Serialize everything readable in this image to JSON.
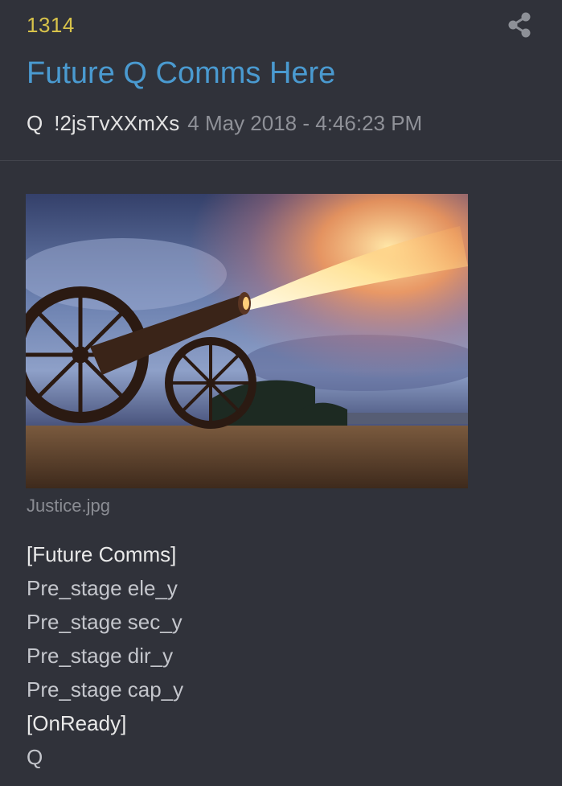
{
  "post": {
    "number": "1314",
    "title": "Future Q Comms Here",
    "author": "Q",
    "tripcode": "!2jsTvXXmXs",
    "timestamp": "4 May 2018 - 4:46:23 PM",
    "share_icon": "share-icon"
  },
  "attachment": {
    "filename": "Justice.jpg",
    "subject": "cannon-firing-photo"
  },
  "body": {
    "lines": [
      {
        "text": "[Future Comms]",
        "kind": "bracket"
      },
      {
        "text": "Pre_stage ele_y",
        "kind": "plain"
      },
      {
        "text": "Pre_stage sec_y",
        "kind": "plain"
      },
      {
        "text": "Pre_stage dir_y",
        "kind": "plain"
      },
      {
        "text": "Pre_stage cap_y",
        "kind": "plain"
      },
      {
        "text": "[OnReady]",
        "kind": "bracket"
      },
      {
        "text": "Q",
        "kind": "plain"
      }
    ]
  },
  "colors": {
    "background": "#30323a",
    "post_number": "#d8c34a",
    "title": "#4a9ad0",
    "timestamp": "#8f9198"
  }
}
